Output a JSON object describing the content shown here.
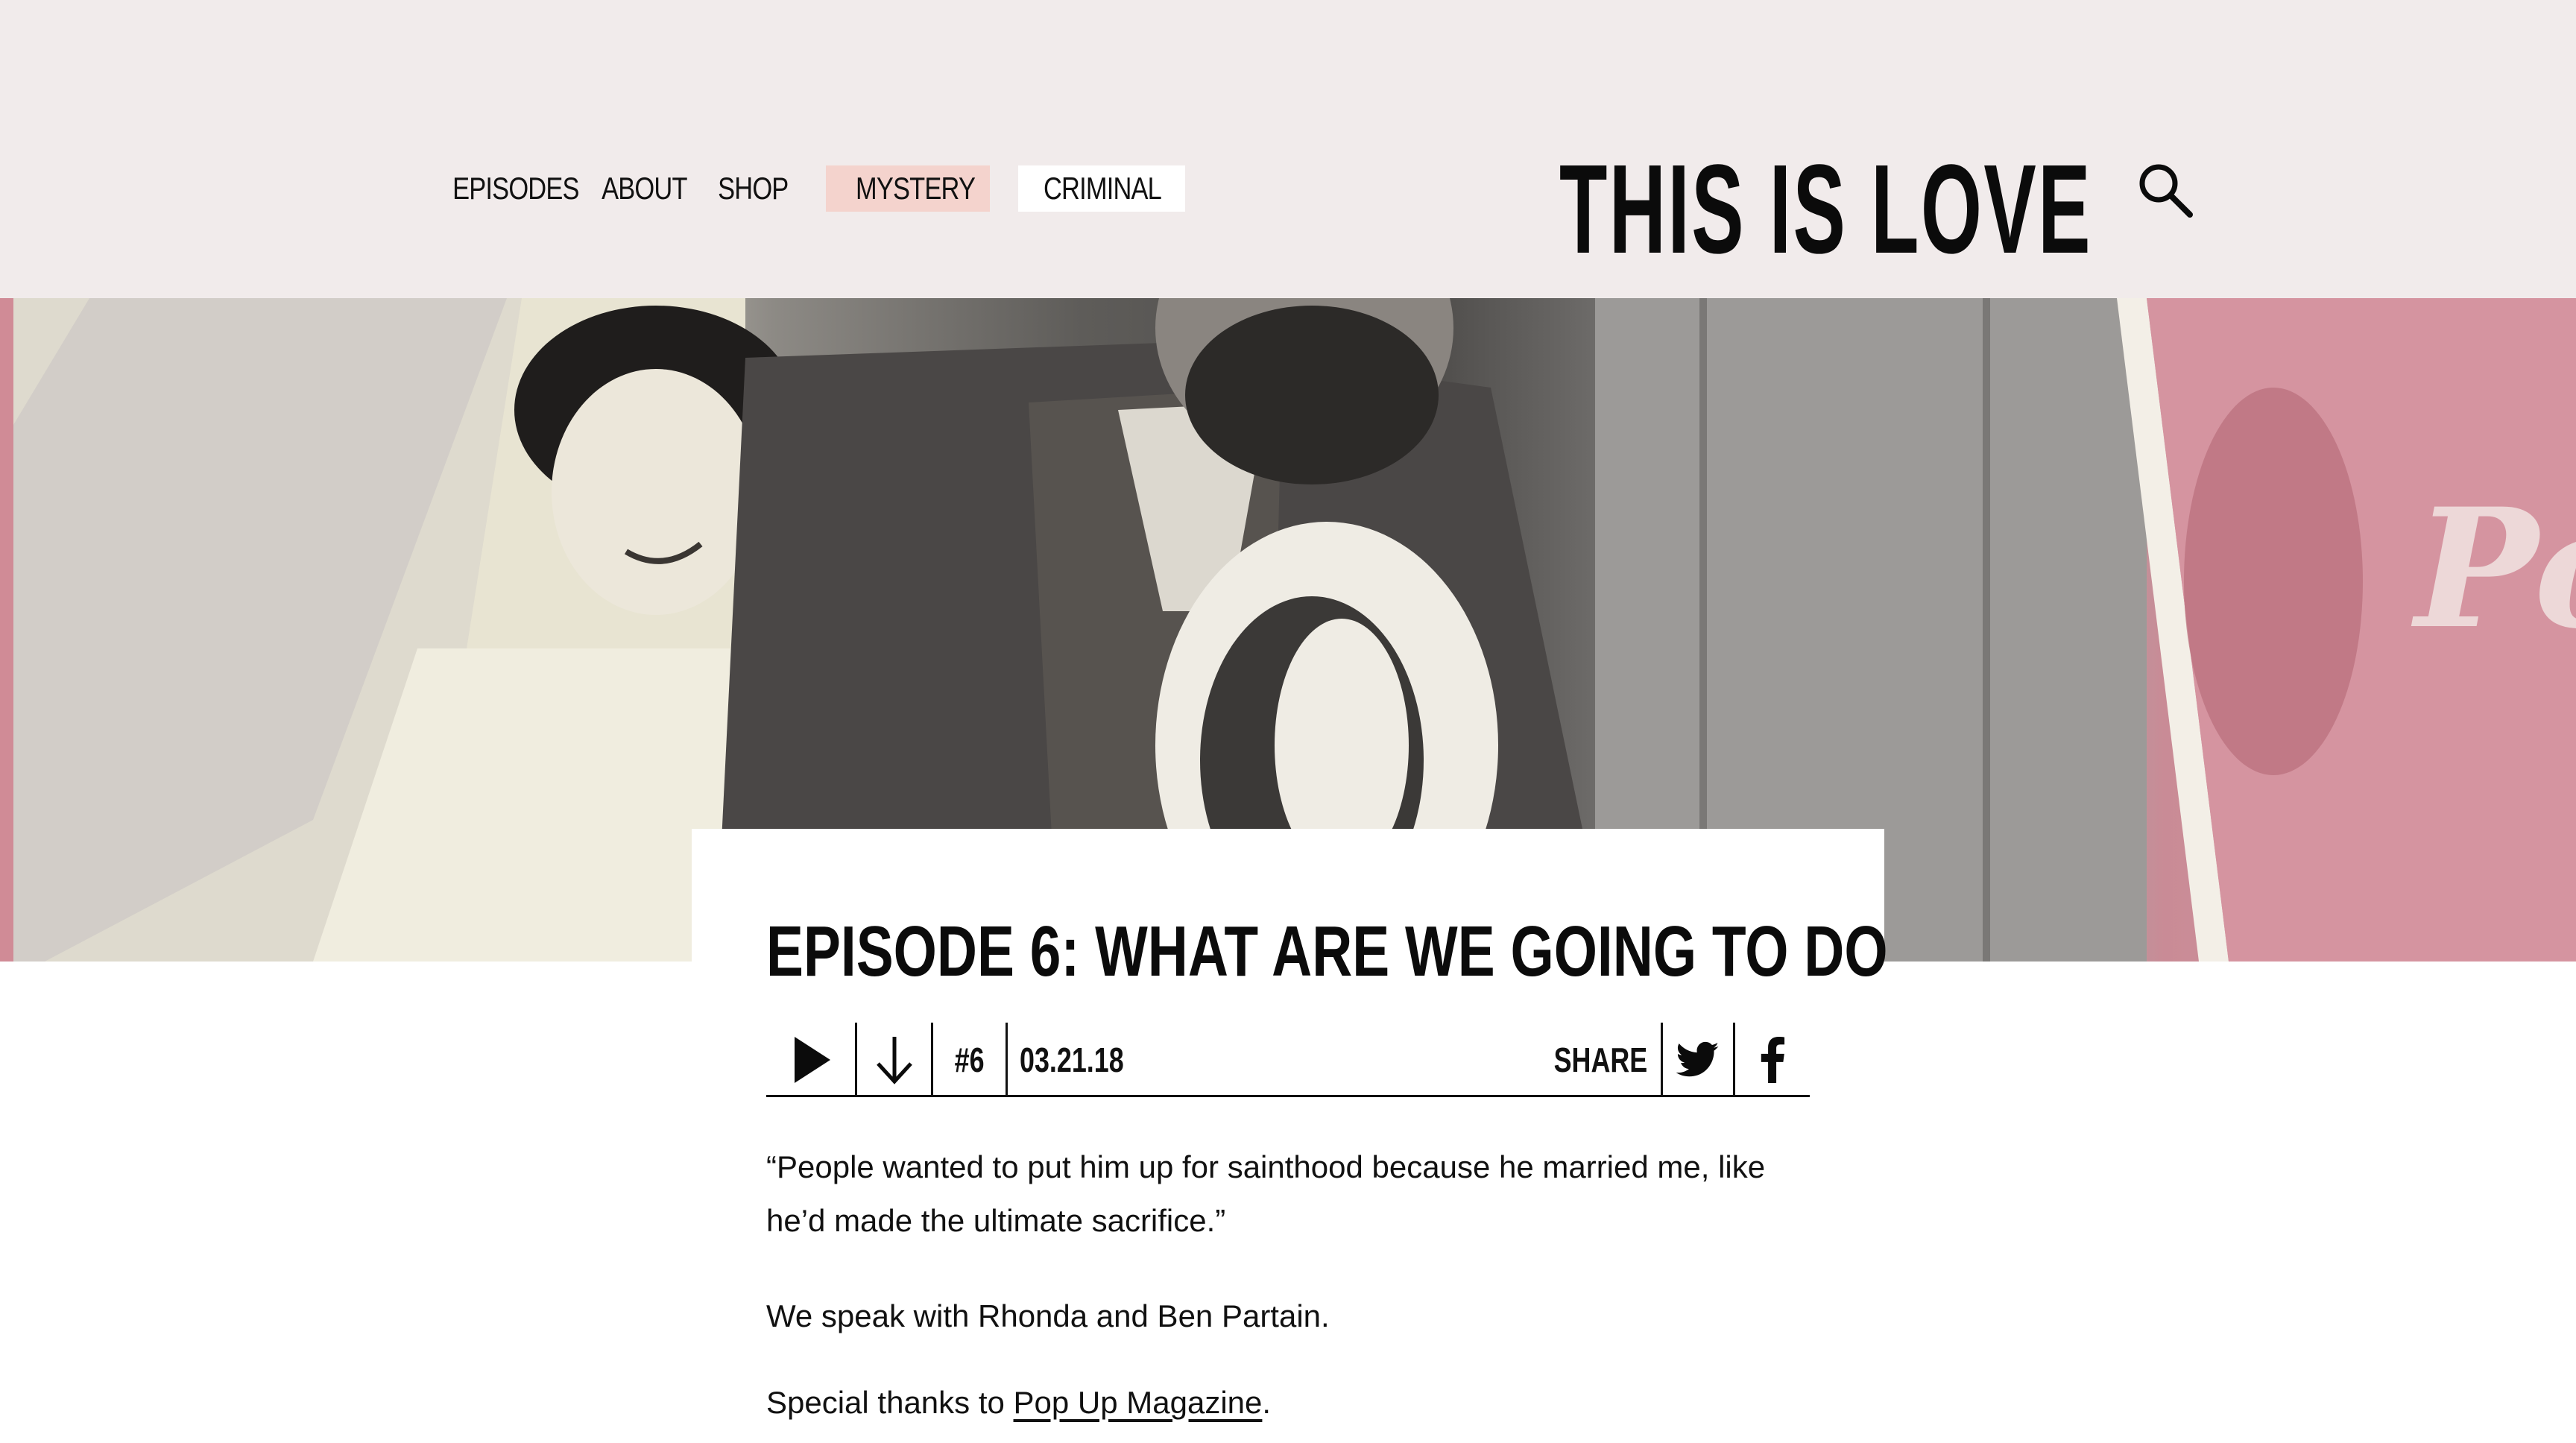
{
  "nav": {
    "items": [
      {
        "label": "EPISODES"
      },
      {
        "label": "ABOUT"
      },
      {
        "label": "SHOP"
      },
      {
        "label": "MYSTERY"
      },
      {
        "label": "CRIMINAL"
      }
    ]
  },
  "logo": {
    "text": "THIS IS LOVE"
  },
  "icons": {
    "search": "search-icon",
    "play": "play-icon",
    "download": "download-icon",
    "twitter": "twitter-icon",
    "facebook": "facebook-icon"
  },
  "colors": {
    "header_bg": "#f1ebeb",
    "mystery_bg": "#f4d3cd",
    "criminal_bg": "#ffffff",
    "text": "#111111"
  },
  "episode": {
    "title": "EPISODE 6: WHAT ARE WE GOING TO DO",
    "number": "#6",
    "date": "03.21.18",
    "share_label": "SHARE",
    "quote": "“People wanted to put him up for sainthood because he married me, like he’d made the ultimate sacrifice.”",
    "speak": "We speak with Rhonda and Ben Partain.",
    "thanks_prefix": "Special thanks to ",
    "thanks_link": "Pop Up Magazine",
    "thanks_suffix": "."
  }
}
